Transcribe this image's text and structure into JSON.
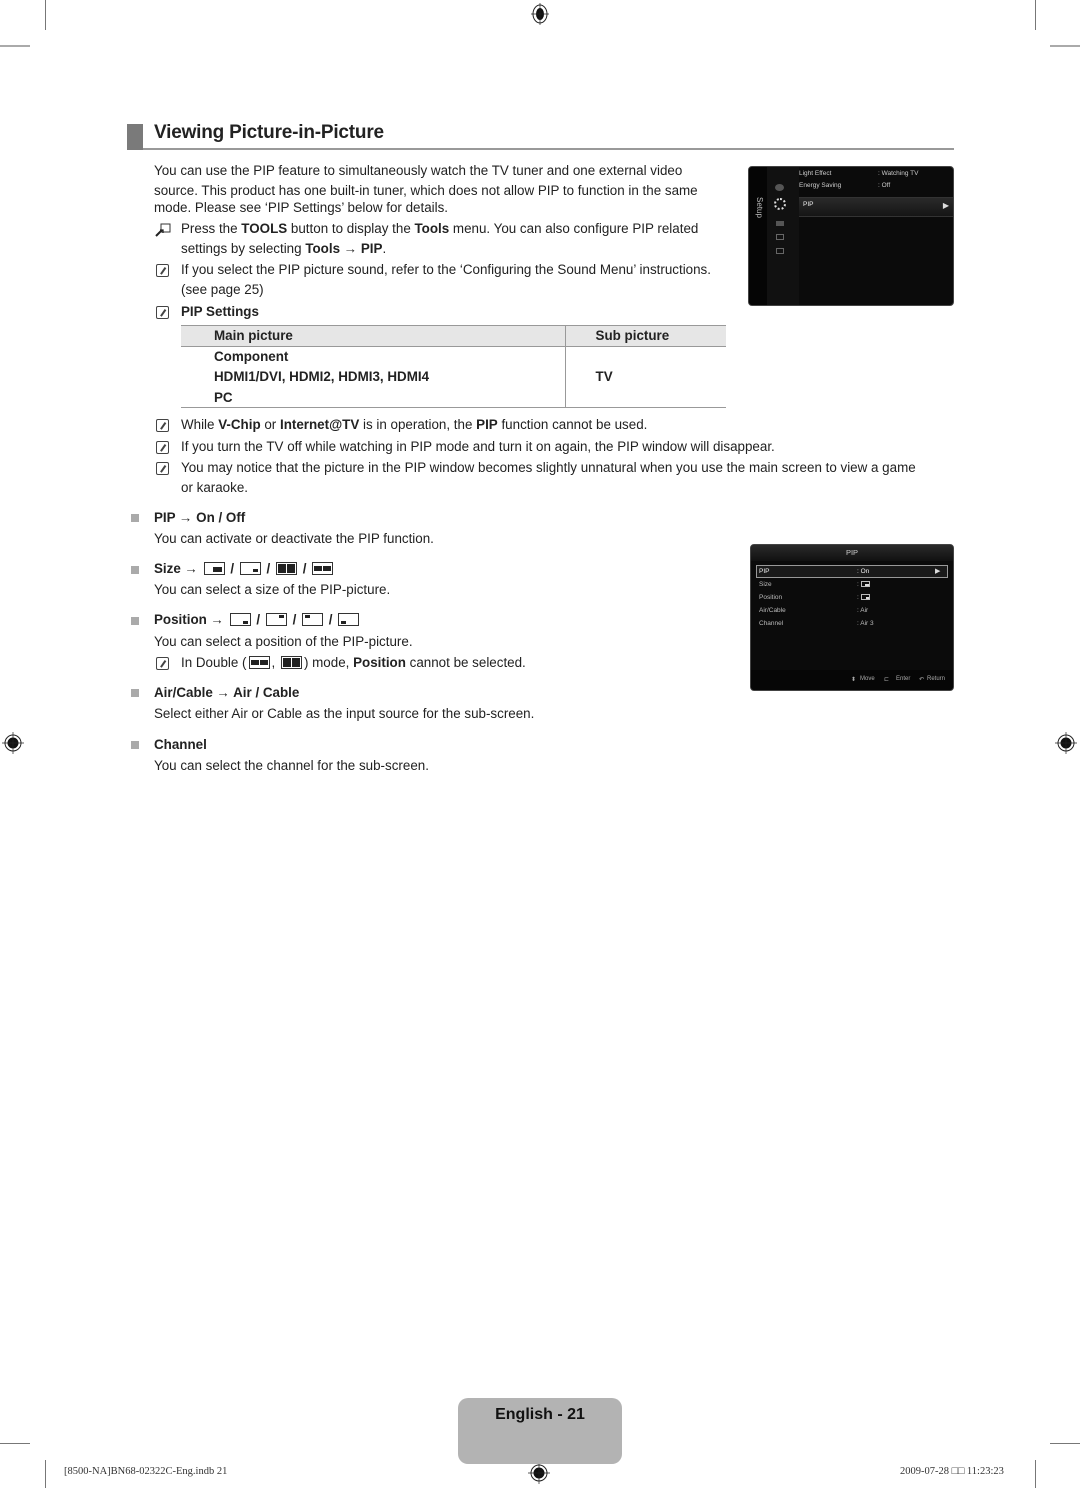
{
  "heading": "Viewing Picture-in-Picture",
  "intro": "You can use the PIP feature to simultaneously watch the TV tuner and one external video source. This product has one built-in tuner, which does not allow PIP to function in the same mode. Please see ‘PIP Settings’ below for details.",
  "intro_lines": [
    "You can use the PIP feature to simultaneously watch the TV tuner and one external video",
    "source. This product has one built-in tuner, which does not allow PIP to function in the same",
    "mode. Please see ‘PIP Settings’ below for details."
  ],
  "tools_note": {
    "line1_pre": "Press the ",
    "line1_b1": "TOOLS",
    "line1_mid": " button to display the ",
    "line1_b2": "Tools",
    "line1_post": " menu. You can also configure PIP related",
    "line2_pre": "settings by selecting ",
    "line2_b": "Tools → PIP",
    "line2_post": "."
  },
  "sound_note": {
    "line1": "If you select the PIP picture sound, refer to the ‘Configuring the Sound Menu’ instructions.",
    "line2": "(see page 25)"
  },
  "pip_settings": {
    "title": "PIP Settings",
    "headers": [
      "Main picture",
      "Sub picture"
    ],
    "main_rows": [
      "Component",
      "HDMI1/DVI, HDMI2, HDMI3, HDMI4",
      "PC"
    ],
    "sub_value": "TV"
  },
  "notes": [
    {
      "pre": "While ",
      "b1": "V-Chip",
      "mid1": " or ",
      "b2": "Internet@TV",
      "mid2": " is in operation, the ",
      "b3": "PIP",
      "post": " function cannot be used."
    },
    {
      "text": "If you turn the TV off while watching in PIP mode and turn it on again, the PIP window will disappear."
    },
    {
      "line1": "You may notice that the picture in the PIP window becomes slightly unnatural when you use the main screen to view a game",
      "line2": "or karaoke."
    }
  ],
  "sections": {
    "pip": {
      "title": "PIP → On / Off",
      "desc": "You can activate or deactivate the PIP function."
    },
    "size": {
      "title": "Size →",
      "desc": "You can select a size of the PIP-picture.",
      "options": [
        "large-bottom-right",
        "small-bottom-right",
        "double-split-tall",
        "double-split-wide"
      ]
    },
    "position": {
      "title": "Position →",
      "desc": "You can select a position of the PIP-picture.",
      "options": [
        "bottom-right",
        "top-right",
        "top-left",
        "bottom-left"
      ],
      "note_pre": "In Double (",
      "note_mid": ", ",
      "note_post": ") mode, ",
      "note_b": "Position",
      "note_end": " cannot be selected."
    },
    "aircable": {
      "title": "Air/Cable → Air / Cable",
      "desc": "Select either Air or Cable as the input source for the sub-screen."
    },
    "channel": {
      "title": "Channel",
      "desc": "You can select the channel for the sub-screen."
    }
  },
  "tv_setup_menu": {
    "side_label": "Setup",
    "rows": [
      {
        "label": "Light Effect",
        "value": ": Watching TV"
      },
      {
        "label": "Energy Saving",
        "value": ": Off"
      }
    ],
    "selected": "PIP"
  },
  "tv_pip_menu": {
    "title": "PIP",
    "rows": [
      {
        "label": "PIP",
        "value": ": On"
      },
      {
        "label": "Size",
        "value": ":"
      },
      {
        "label": "Position",
        "value": ":"
      },
      {
        "label": "Air/Cable",
        "value": ": Air"
      },
      {
        "label": "Channel",
        "value": ": Air 3"
      }
    ],
    "footer": {
      "move": "Move",
      "enter": "Enter",
      "return": "Return"
    }
  },
  "page_label": "English - 21",
  "slug_left": "[8500-NA]BN68-02322C-Eng.indb   21",
  "slug_right": "2009-07-28   □□ 11:23:23"
}
